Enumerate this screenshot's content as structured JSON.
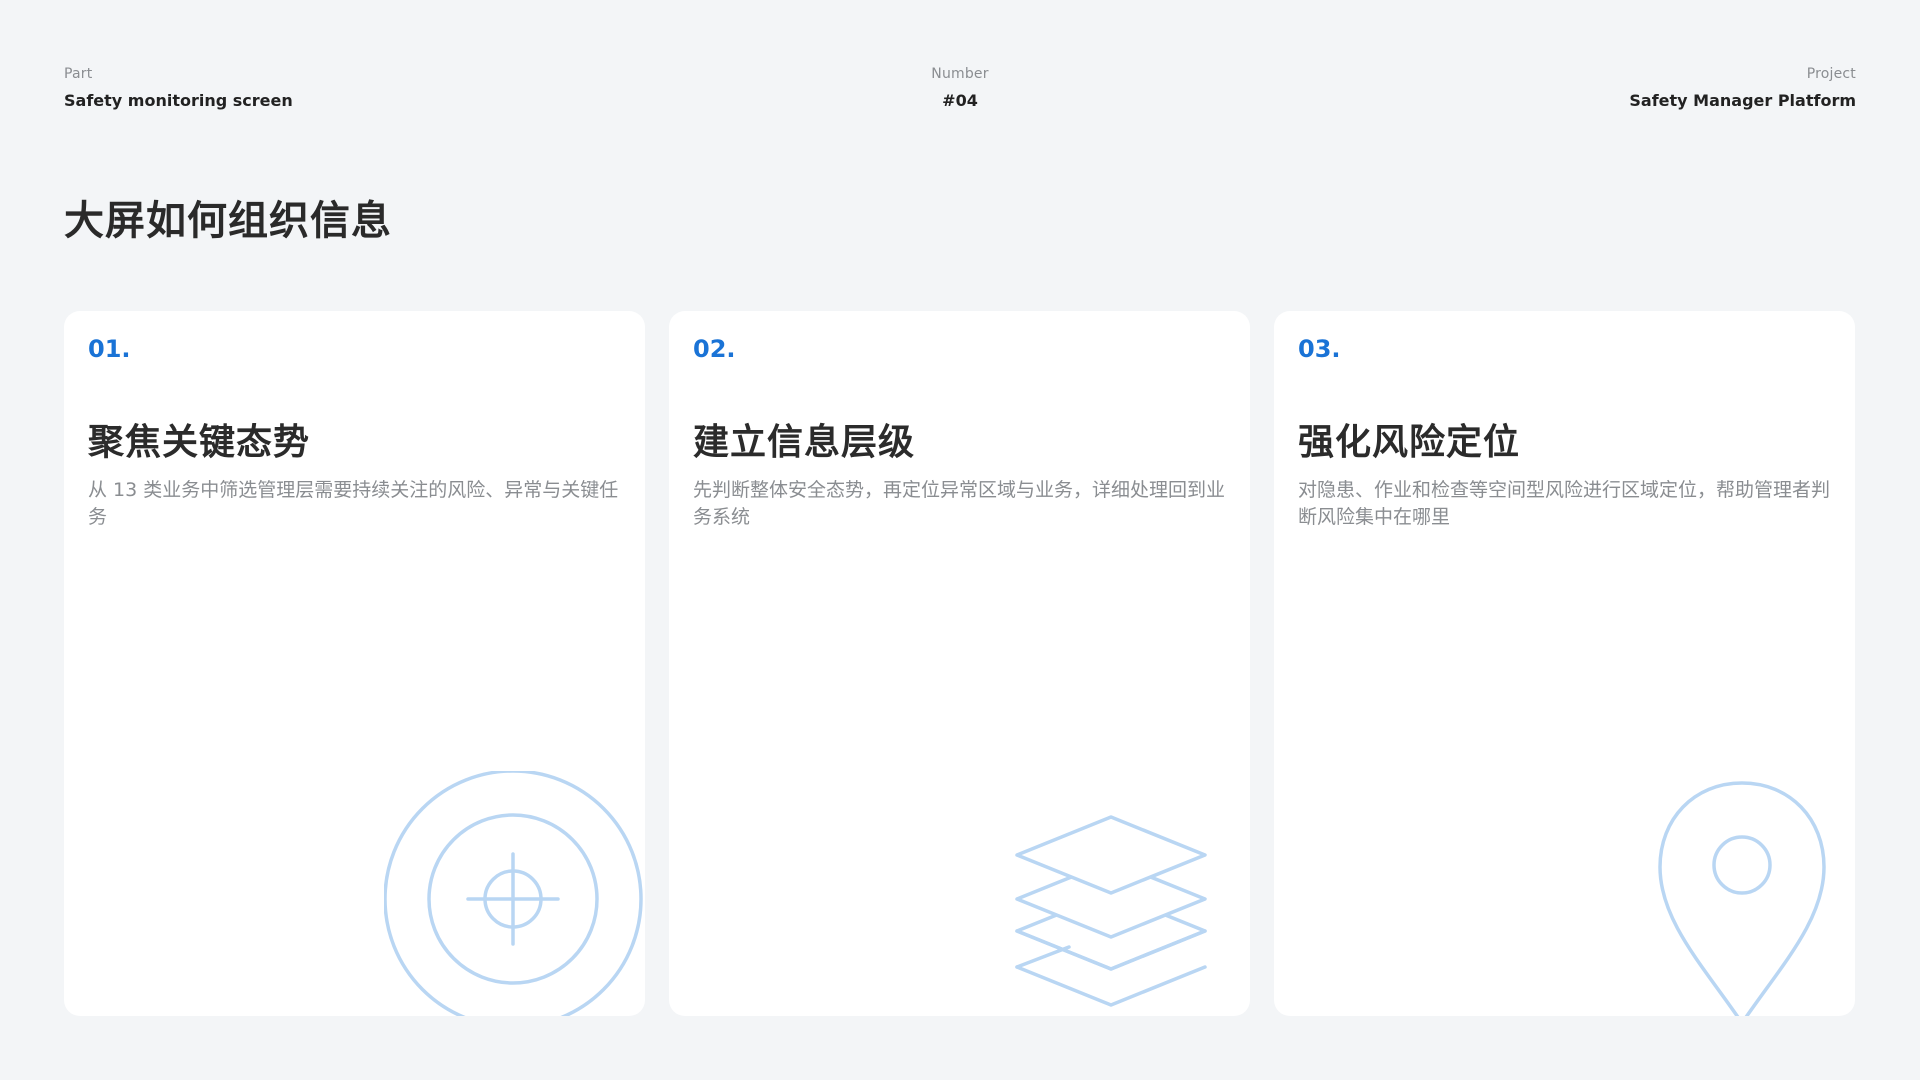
{
  "header": {
    "part_label": "Part",
    "part_value": "Safety monitoring screen",
    "number_label": "Number",
    "number_value": "#04",
    "project_label": "Project",
    "project_value": "Safety Manager Platform"
  },
  "page_title": "大屏如何组织信息",
  "colors": {
    "accent": "#1a73d6",
    "icon_line": "#b9d6f3",
    "background": "#f3f5f7",
    "card": "#ffffff"
  },
  "cards": [
    {
      "number": "01.",
      "title": "聚焦关键态势",
      "description": "从 13 类业务中筛选管理层需要持续关注的风险、异常与关键任务",
      "icon": "crosshair-target-icon"
    },
    {
      "number": "02.",
      "title": "建立信息层级",
      "description": "先判断整体安全态势，再定位异常区域与业务，详细处理回到业务系统",
      "icon": "layers-icon"
    },
    {
      "number": "03.",
      "title": "强化风险定位",
      "description": "对隐患、作业和检查等空间型风险进行区域定位，帮助管理者判断风险集中在哪里",
      "icon": "location-pin-icon"
    }
  ]
}
